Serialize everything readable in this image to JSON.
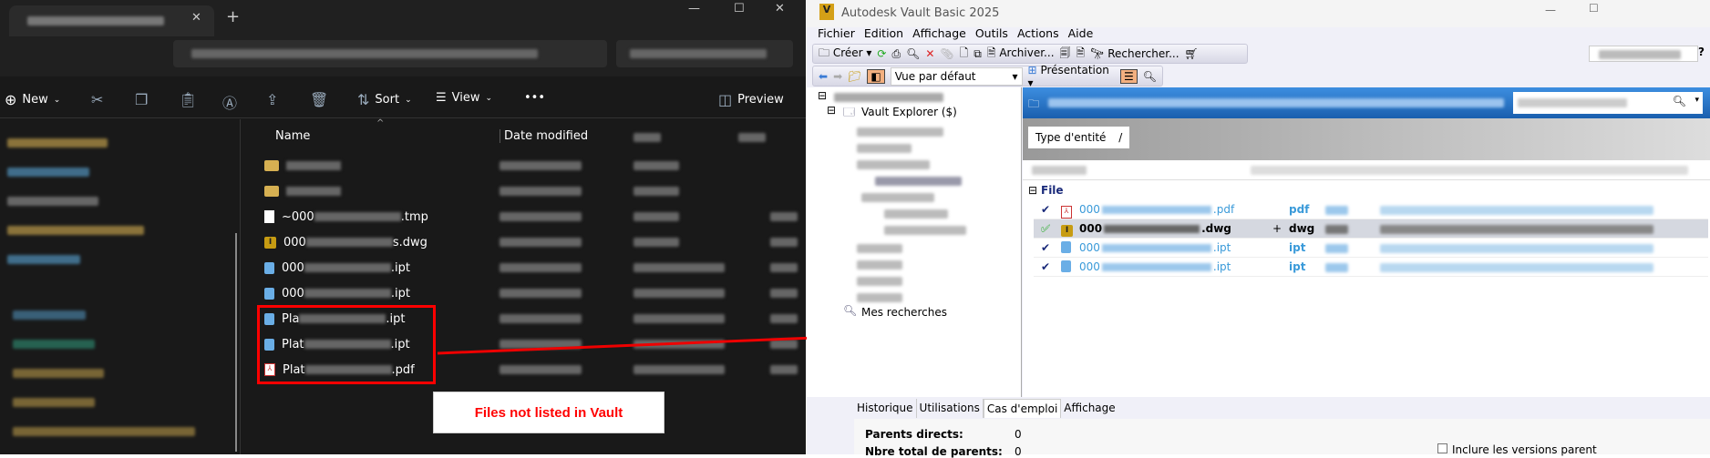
{
  "explorer": {
    "toolbar": {
      "new": "New",
      "sort": "Sort",
      "view": "View",
      "more": "•••",
      "preview": "Preview"
    },
    "columns": {
      "name": "Name",
      "date": "Date modified"
    },
    "files": [
      {
        "icon": "folder",
        "prefix": "",
        "ext": ""
      },
      {
        "icon": "folder",
        "prefix": "",
        "ext": ""
      },
      {
        "icon": "tmp",
        "prefix": "~000",
        "ext": ".tmp"
      },
      {
        "icon": "dwg",
        "prefix": "000",
        "ext": "s.dwg"
      },
      {
        "icon": "ipt",
        "prefix": "000",
        "ext": ".ipt"
      },
      {
        "icon": "ipt",
        "prefix": "000",
        "ext": ".ipt"
      },
      {
        "icon": "ipt",
        "prefix": "Pla",
        "ext": ".ipt"
      },
      {
        "icon": "ipt",
        "prefix": "Plat",
        "ext": ".ipt"
      },
      {
        "icon": "pdf",
        "prefix": "Plat",
        "ext": ".pdf"
      }
    ]
  },
  "annotation": {
    "label": "Files not listed in Vault",
    "color": "#ff0000"
  },
  "vault": {
    "title": "Autodesk Vault Basic 2025",
    "menu": [
      "Fichier",
      "Edition",
      "Affichage",
      "Outils",
      "Actions",
      "Aide"
    ],
    "toolbar": {
      "create": "Créer",
      "archive": "Archiver...",
      "search": "Rechercher...",
      "view_select": "Vue par défaut",
      "presentation": "Présentation"
    },
    "tree": {
      "vault_explorer": "Vault Explorer ($)",
      "my_searches": "Mes recherches"
    },
    "group_by": "Type d'entité",
    "group": "File",
    "rows": [
      {
        "prefix": "000",
        "suffix": ".pdf",
        "type": "pdf",
        "icon": "pdf",
        "status": "checked",
        "bold": false
      },
      {
        "prefix": "000",
        "suffix": ".dwg",
        "type": "dwg",
        "icon": "dwg",
        "status": "checked-out",
        "bold": true
      },
      {
        "prefix": "000",
        "suffix": ".ipt",
        "type": "ipt",
        "icon": "ipt",
        "status": "checked",
        "bold": false
      },
      {
        "prefix": "000",
        "suffix": ".ipt",
        "type": "ipt",
        "icon": "ipt",
        "status": "checked",
        "bold": false
      }
    ],
    "tabs": [
      "Historique",
      "Utilisations",
      "Cas d'emploi",
      "Affichage"
    ],
    "active_tab": "Cas d'emploi",
    "details": {
      "direct_parents_label": "Parents directs:",
      "direct_parents": "0",
      "total_parents_label": "Nbre total de parents:",
      "total_parents": "0",
      "include_versions": "Inclure les versions parent"
    }
  }
}
